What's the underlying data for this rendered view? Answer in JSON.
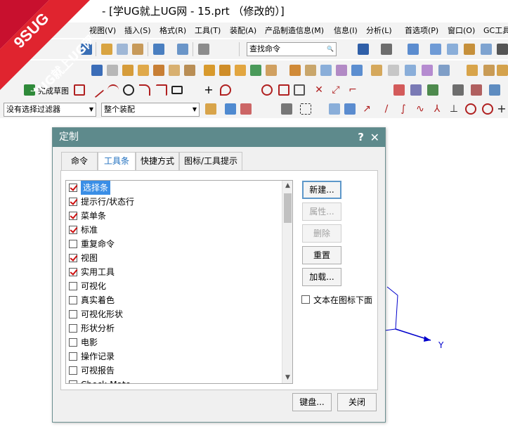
{
  "window": {
    "title": "- [学UG就上UG网 - 15.prt （修改的）]"
  },
  "watermark": {
    "line1": "9SUG",
    "line2": "学UG就上UG网"
  },
  "menubar": {
    "items": [
      "视图(V)",
      "插入(S)",
      "格式(R)",
      "工具(T)",
      "装配(A)",
      "产品制造信息(M)",
      "信息(I)",
      "分析(L)",
      "首选项(P)",
      "窗口(O)",
      "GC工具"
    ]
  },
  "toolbar": {
    "find_command_placeholder": "查找命令",
    "finish_sketch_label": "完成草图",
    "selection_filter": "没有选择过滤器",
    "assembly_scope": "整个装配"
  },
  "canvas": {
    "axis_y_label": "Y"
  },
  "dialog": {
    "title": "定制",
    "help": "?",
    "close": "✕",
    "tabs": [
      "命令",
      "工具条",
      "快捷方式",
      "图标/工具提示"
    ],
    "active_tab": "工具条",
    "toolbars": [
      {
        "label": "选择条",
        "checked": true,
        "selected": true
      },
      {
        "label": "提示行/状态行",
        "checked": true
      },
      {
        "label": "菜单条",
        "checked": true
      },
      {
        "label": "标准",
        "checked": true
      },
      {
        "label": "重复命令",
        "checked": false
      },
      {
        "label": "视图",
        "checked": true
      },
      {
        "label": "实用工具",
        "checked": true
      },
      {
        "label": "可视化",
        "checked": false
      },
      {
        "label": "真实着色",
        "checked": false
      },
      {
        "label": "可视化形状",
        "checked": false
      },
      {
        "label": "形状分析",
        "checked": false
      },
      {
        "label": "电影",
        "checked": false
      },
      {
        "label": "操作记录",
        "checked": false
      },
      {
        "label": "可视报告",
        "checked": false
      },
      {
        "label": "Check-Mate",
        "checked": false
      }
    ],
    "buttons": {
      "new": "新建...",
      "properties": "属性...",
      "delete": "删除",
      "reset": "重置",
      "load": "加载..."
    },
    "text_below_icon": "文本在图标下面",
    "keyboard": "键盘...",
    "close_button": "关闭"
  }
}
